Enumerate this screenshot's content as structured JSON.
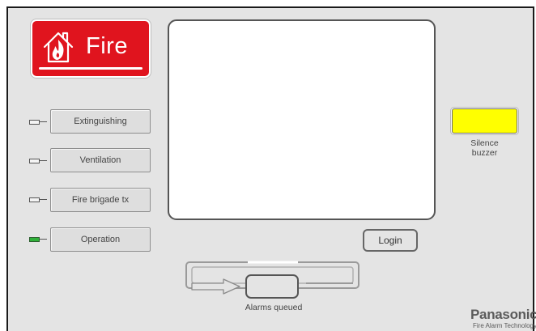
{
  "fire_badge": {
    "label": "Fire",
    "icon": "house-fire-icon",
    "color": "#e0141e"
  },
  "status_buttons": [
    {
      "label": "Extinguishing",
      "led": "off"
    },
    {
      "label": "Ventilation",
      "led": "off"
    },
    {
      "label": "Fire brigade tx",
      "led": "off"
    },
    {
      "label": "Operation",
      "led": "on"
    }
  ],
  "silence": {
    "label": "Silence\nbuzzer",
    "color": "#ffff00"
  },
  "login": {
    "label": "Login"
  },
  "alarms_queue": {
    "label": "Alarms queued"
  },
  "brand": {
    "name": "Panasonic",
    "tagline": "Fire Alarm Technology"
  },
  "colors": {
    "panel_bg": "#e4e4e4",
    "led_on": "#2fb13a"
  }
}
